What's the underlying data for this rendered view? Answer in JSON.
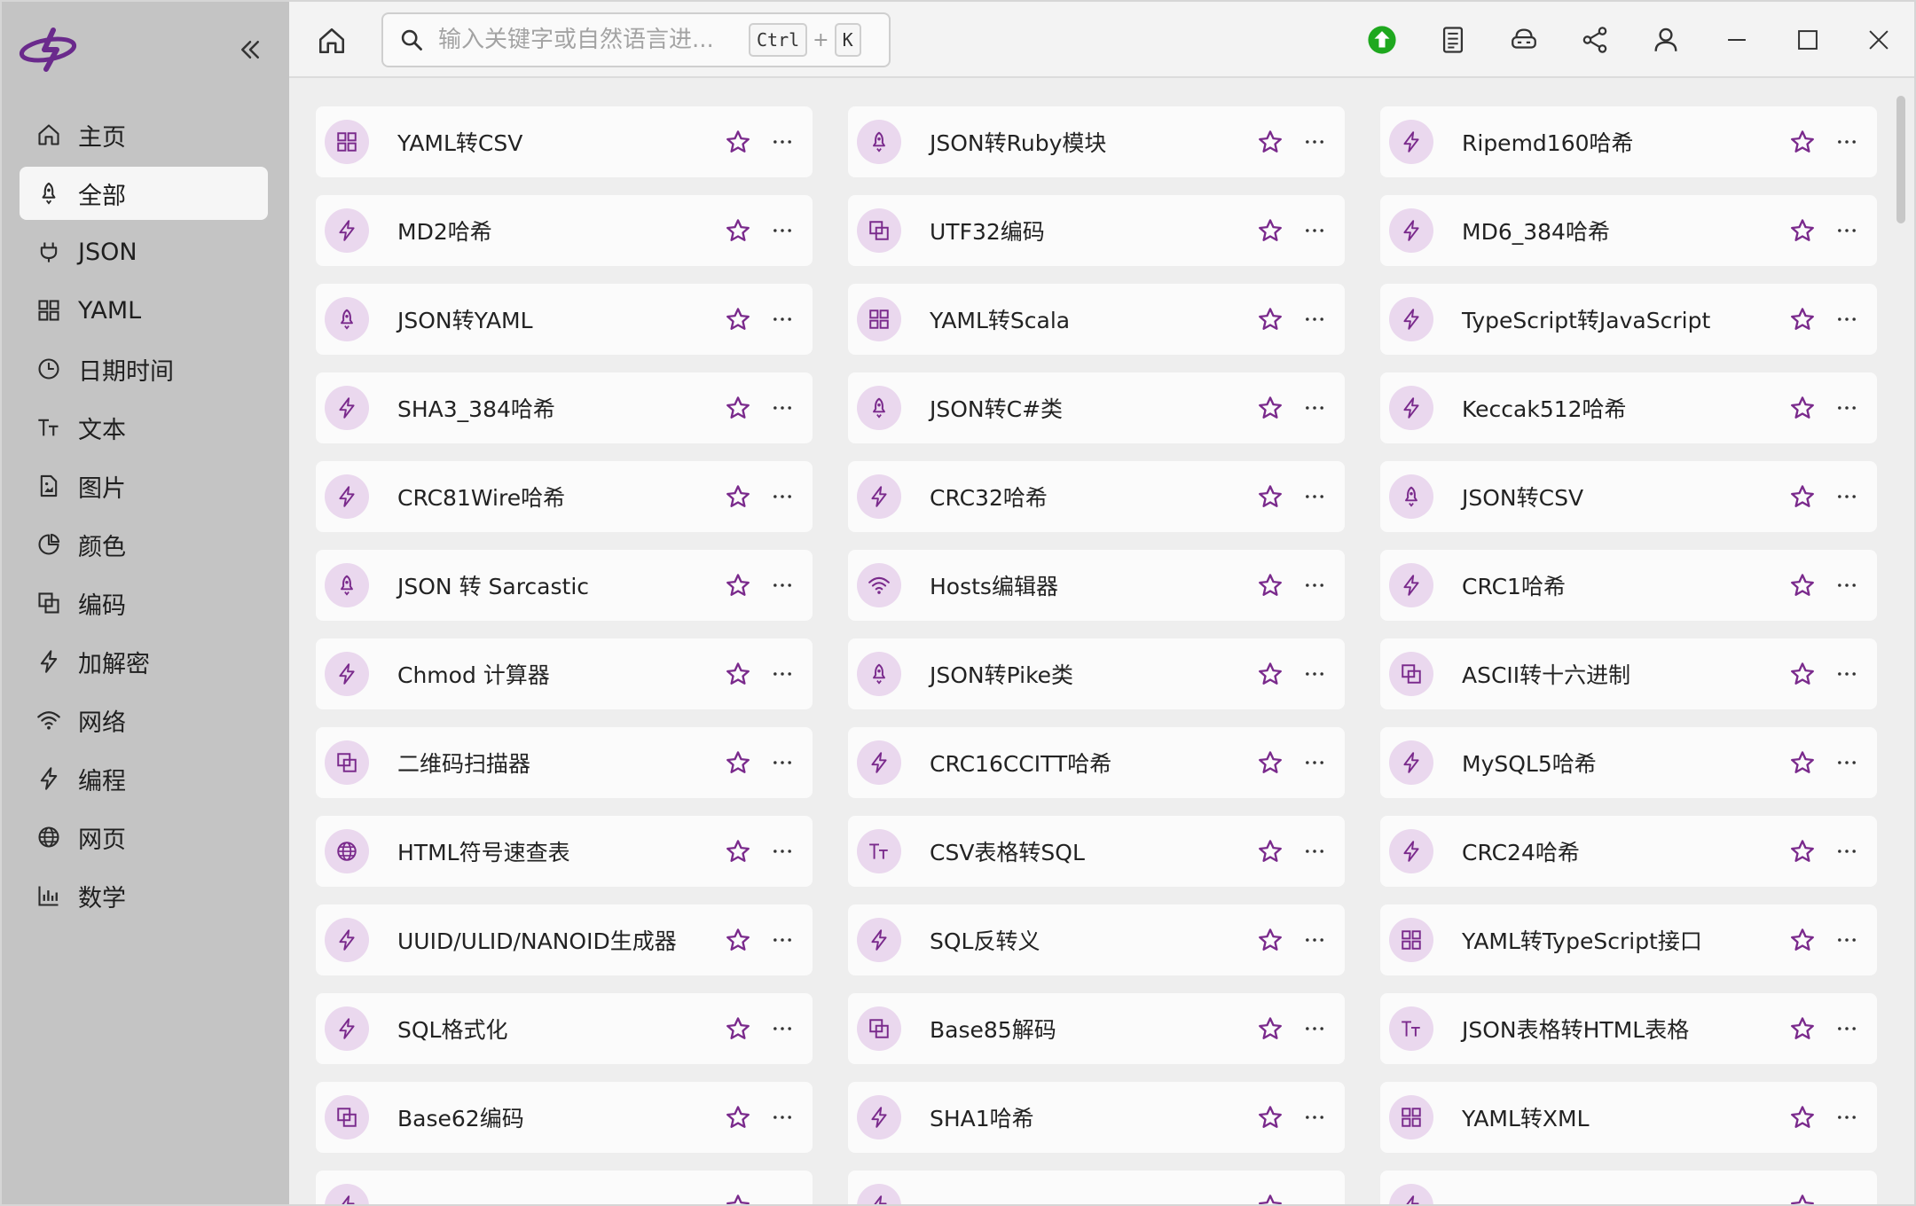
{
  "sidebar": {
    "items": [
      {
        "label": "主页",
        "icon": "home-icon",
        "active": false
      },
      {
        "label": "全部",
        "icon": "rocket-icon",
        "active": true
      },
      {
        "label": "JSON",
        "icon": "plug-icon",
        "active": false
      },
      {
        "label": "YAML",
        "icon": "grid-icon",
        "active": false
      },
      {
        "label": "日期时间",
        "icon": "clock-icon",
        "active": false
      },
      {
        "label": "文本",
        "icon": "text-icon",
        "active": false
      },
      {
        "label": "图片",
        "icon": "image-file-icon",
        "active": false
      },
      {
        "label": "颜色",
        "icon": "pie-icon",
        "active": false
      },
      {
        "label": "编码",
        "icon": "encode-icon",
        "active": false
      },
      {
        "label": "加解密",
        "icon": "bolt-icon",
        "active": false
      },
      {
        "label": "网络",
        "icon": "wifi-icon",
        "active": false
      },
      {
        "label": "编程",
        "icon": "bolt-icon",
        "active": false
      },
      {
        "label": "网页",
        "icon": "globe-icon",
        "active": false
      },
      {
        "label": "数学",
        "icon": "bar-chart-icon",
        "active": false
      }
    ]
  },
  "search": {
    "placeholder": "输入关键字或自然语言进...",
    "shortcut_key1": "Ctrl",
    "shortcut_plus": "+",
    "shortcut_key2": "K"
  },
  "accent_color": "#7a2a8c",
  "cards": [
    {
      "label": "YAML转CSV",
      "icon": "grid"
    },
    {
      "label": "JSON转Ruby模块",
      "icon": "rocket"
    },
    {
      "label": "Ripemd160哈希",
      "icon": "bolt"
    },
    {
      "label": "MD2哈希",
      "icon": "bolt"
    },
    {
      "label": "UTF32编码",
      "icon": "encode"
    },
    {
      "label": "MD6_384哈希",
      "icon": "bolt"
    },
    {
      "label": "JSON转YAML",
      "icon": "rocket"
    },
    {
      "label": "YAML转Scala",
      "icon": "grid"
    },
    {
      "label": "TypeScript转JavaScript",
      "icon": "bolt"
    },
    {
      "label": "SHA3_384哈希",
      "icon": "bolt"
    },
    {
      "label": "JSON转C#类",
      "icon": "rocket"
    },
    {
      "label": "Keccak512哈希",
      "icon": "bolt"
    },
    {
      "label": "CRC81Wire哈希",
      "icon": "bolt"
    },
    {
      "label": "CRC32哈希",
      "icon": "bolt"
    },
    {
      "label": "JSON转CSV",
      "icon": "rocket"
    },
    {
      "label": "JSON 转 Sarcastic",
      "icon": "rocket"
    },
    {
      "label": "Hosts编辑器",
      "icon": "wifi"
    },
    {
      "label": "CRC1哈希",
      "icon": "bolt"
    },
    {
      "label": "Chmod 计算器",
      "icon": "bolt"
    },
    {
      "label": "JSON转Pike类",
      "icon": "rocket"
    },
    {
      "label": "ASCII转十六进制",
      "icon": "encode"
    },
    {
      "label": "二维码扫描器",
      "icon": "encode"
    },
    {
      "label": "CRC16CCITT哈希",
      "icon": "bolt"
    },
    {
      "label": "MySQL5哈希",
      "icon": "bolt"
    },
    {
      "label": "HTML符号速查表",
      "icon": "globe"
    },
    {
      "label": "CSV表格转SQL",
      "icon": "text"
    },
    {
      "label": "CRC24哈希",
      "icon": "bolt"
    },
    {
      "label": "UUID/ULID/NANOID生成器",
      "icon": "bolt"
    },
    {
      "label": "SQL反转义",
      "icon": "bolt"
    },
    {
      "label": "YAML转TypeScript接口",
      "icon": "grid"
    },
    {
      "label": "SQL格式化",
      "icon": "bolt"
    },
    {
      "label": "Base85解码",
      "icon": "encode"
    },
    {
      "label": "JSON表格转HTML表格",
      "icon": "text"
    },
    {
      "label": "Base62编码",
      "icon": "encode"
    },
    {
      "label": "SHA1哈希",
      "icon": "bolt"
    },
    {
      "label": "YAML转XML",
      "icon": "grid"
    },
    {
      "label": "",
      "icon": "bolt"
    },
    {
      "label": "",
      "icon": "bolt"
    },
    {
      "label": "",
      "icon": "bolt"
    }
  ]
}
